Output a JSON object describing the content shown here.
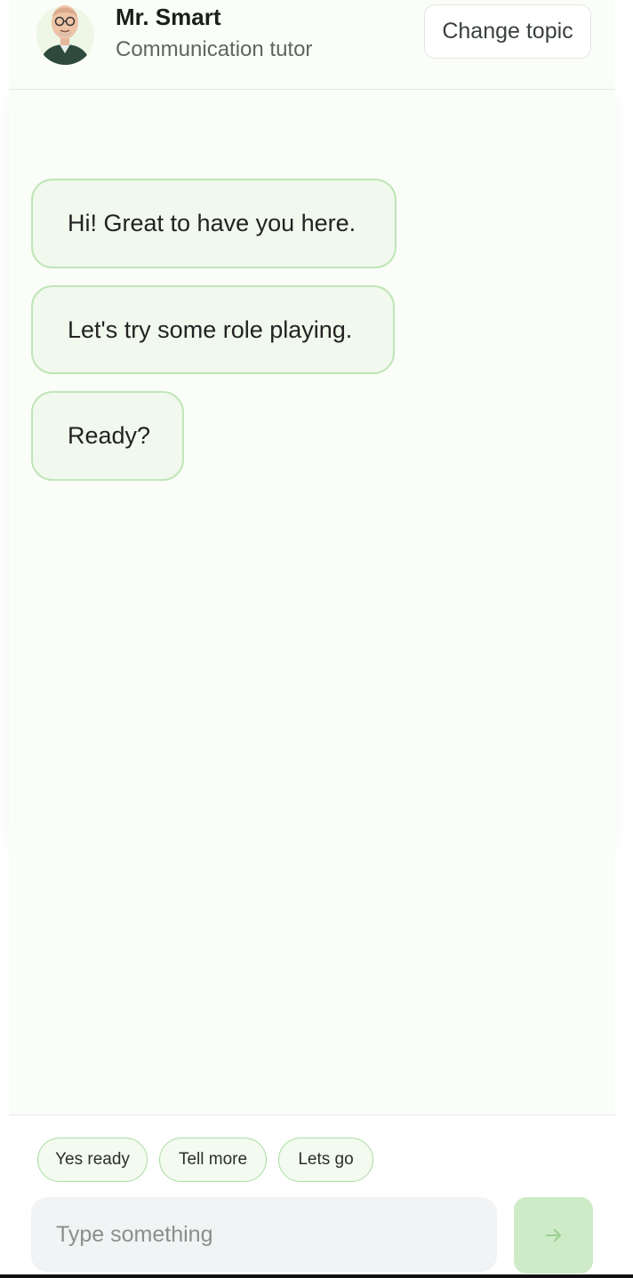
{
  "header": {
    "tutor_name": "Mr. Smart",
    "tutor_role": "Communication tutor",
    "change_topic_label": "Change topic"
  },
  "messages": [
    {
      "text": "Hi! Great to have you here."
    },
    {
      "text": "Let's try some role playing."
    },
    {
      "text": "Ready?"
    }
  ],
  "quick_replies": [
    "Yes ready",
    "Tell more",
    "Lets go"
  ],
  "composer": {
    "placeholder": "Type something",
    "value": "",
    "send_icon": "arrow-right-icon"
  },
  "colors": {
    "bubble_bg": "#f1f8ed",
    "bubble_border": "#bfe6b8",
    "send_bg": "#cdebc6",
    "app_bg": "#fbfdf8"
  }
}
